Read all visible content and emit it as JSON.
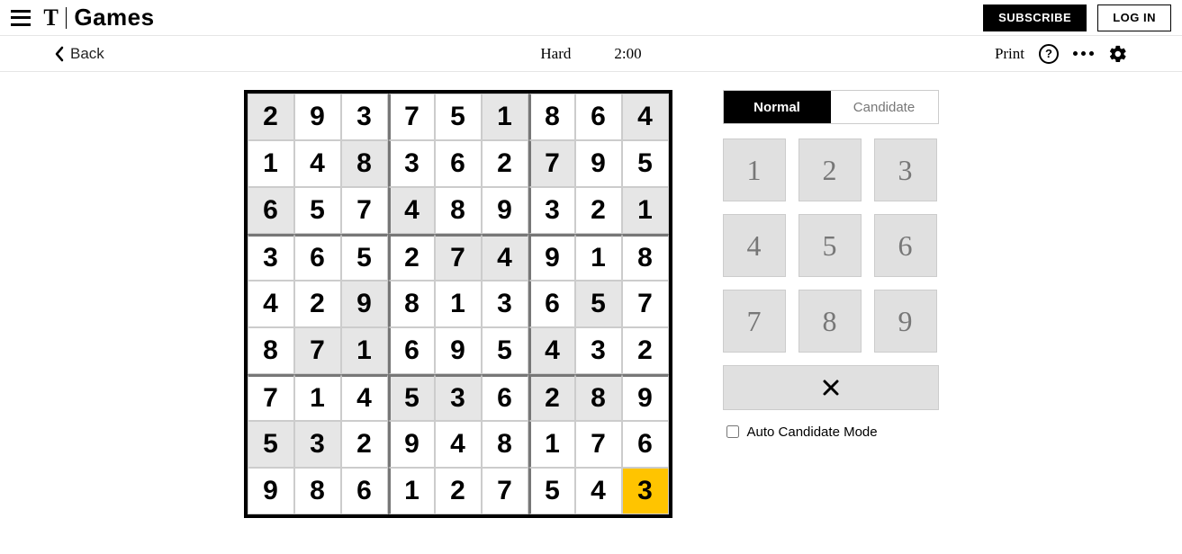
{
  "header": {
    "brand_t": "T",
    "brand_games": "Games",
    "subscribe": "SUBSCRIBE",
    "login": "LOG IN"
  },
  "toolbar": {
    "back": "Back",
    "difficulty": "Hard",
    "timer": "2:00",
    "print": "Print",
    "help_glyph": "?"
  },
  "modes": {
    "normal": "Normal",
    "candidate": "Candidate",
    "active": "normal"
  },
  "keypad": [
    "1",
    "2",
    "3",
    "4",
    "5",
    "6",
    "7",
    "8",
    "9"
  ],
  "auto_label": "Auto Candidate Mode",
  "sudoku": {
    "givens": [
      [
        1,
        0,
        0,
        0,
        0,
        1,
        0,
        0,
        1
      ],
      [
        0,
        0,
        1,
        0,
        0,
        0,
        1,
        0,
        0
      ],
      [
        1,
        0,
        0,
        1,
        0,
        0,
        0,
        0,
        1
      ],
      [
        0,
        0,
        0,
        0,
        1,
        1,
        0,
        0,
        0
      ],
      [
        0,
        0,
        1,
        0,
        0,
        0,
        0,
        1,
        0
      ],
      [
        0,
        1,
        1,
        0,
        0,
        0,
        1,
        0,
        0
      ],
      [
        0,
        0,
        0,
        1,
        1,
        0,
        1,
        1,
        0
      ],
      [
        1,
        1,
        0,
        0,
        0,
        0,
        0,
        0,
        0
      ],
      [
        0,
        0,
        0,
        0,
        0,
        0,
        0,
        0,
        0
      ]
    ],
    "values": [
      [
        "2",
        "9",
        "3",
        "7",
        "5",
        "1",
        "8",
        "6",
        "4"
      ],
      [
        "1",
        "4",
        "8",
        "3",
        "6",
        "2",
        "7",
        "9",
        "5"
      ],
      [
        "6",
        "5",
        "7",
        "4",
        "8",
        "9",
        "3",
        "2",
        "1"
      ],
      [
        "3",
        "6",
        "5",
        "2",
        "7",
        "4",
        "9",
        "1",
        "8"
      ],
      [
        "4",
        "2",
        "9",
        "8",
        "1",
        "3",
        "6",
        "5",
        "7"
      ],
      [
        "8",
        "7",
        "1",
        "6",
        "9",
        "5",
        "4",
        "3",
        "2"
      ],
      [
        "7",
        "1",
        "4",
        "5",
        "3",
        "6",
        "2",
        "8",
        "9"
      ],
      [
        "5",
        "3",
        "2",
        "9",
        "4",
        "8",
        "1",
        "7",
        "6"
      ],
      [
        "9",
        "8",
        "6",
        "1",
        "2",
        "7",
        "5",
        "4",
        "3"
      ]
    ],
    "selected": [
      8,
      8
    ]
  }
}
